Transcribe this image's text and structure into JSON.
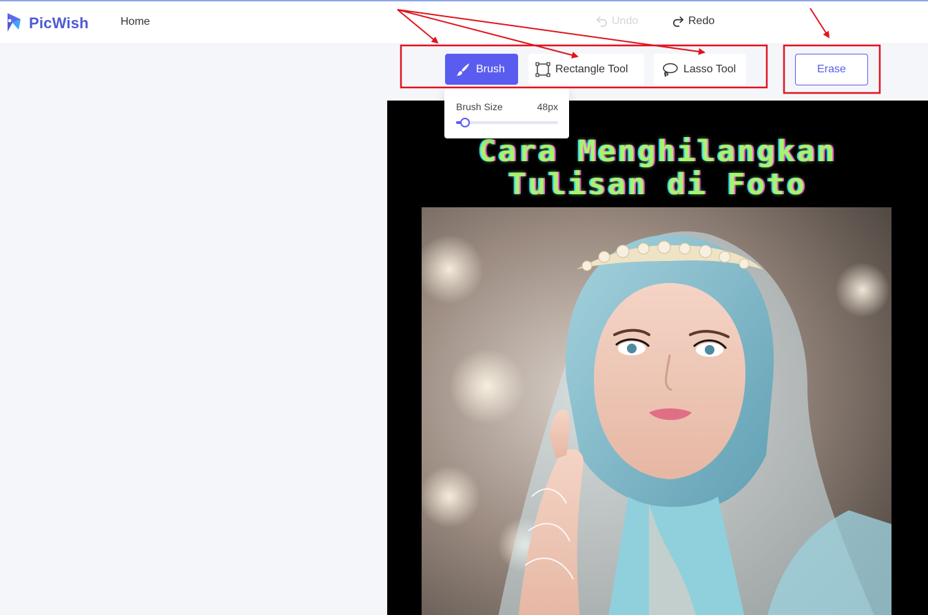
{
  "app": {
    "brand": "PicWish",
    "nav_home": "Home"
  },
  "history": {
    "undo_label": "Undo",
    "redo_label": "Redo"
  },
  "tools": {
    "brush_label": "Brush",
    "rectangle_label": "Rectangle Tool",
    "lasso_label": "Lasso Tool",
    "selected": "Brush"
  },
  "erase_label": "Erase",
  "brush_panel": {
    "size_label": "Brush Size",
    "size_value": "48px",
    "slider_fraction": 0.09
  },
  "image": {
    "headline_line1": "Cara Menghilangkan",
    "headline_line2": "Tulisan di Foto"
  },
  "colors": {
    "accent": "#5a5cf0",
    "annotation": "#e0141e"
  },
  "icons": [
    "picwish-logo-icon",
    "undo-icon",
    "redo-icon",
    "brush-icon",
    "rectangle-icon",
    "lasso-icon"
  ]
}
